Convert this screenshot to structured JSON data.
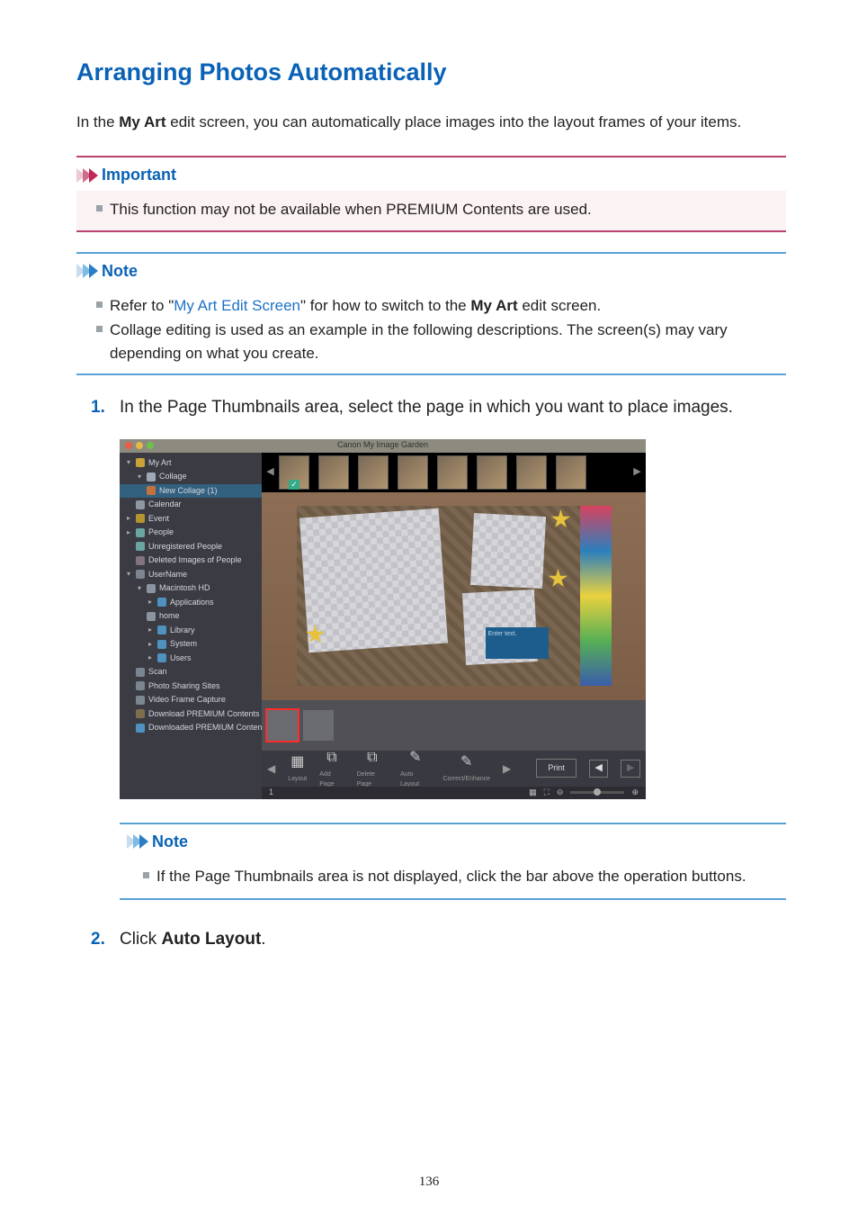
{
  "title": "Arranging Photos Automatically",
  "intro_before": "In the ",
  "intro_bold": "My Art",
  "intro_after": " edit screen, you can automatically place images into the layout frames of your items.",
  "important": {
    "label": "Important",
    "item1": "This function may not be available when PREMIUM Contents are used."
  },
  "note1": {
    "label": "Note",
    "item1_before": "Refer to \"",
    "item1_link": "My Art Edit Screen",
    "item1_after": "\" for how to switch to the ",
    "item1_bold": "My Art",
    "item1_end": " edit screen.",
    "item2": "Collage editing is used as an example in the following descriptions. The screen(s) may vary depending on what you create."
  },
  "step1": "In the Page Thumbnails area, select the page in which you want to place images.",
  "step2_before": "Click ",
  "step2_bold": "Auto Layout",
  "step2_after": ".",
  "inner_note": {
    "label": "Note",
    "item1": "If the Page Thumbnails area is not displayed, click the bar above the operation buttons."
  },
  "screenshot": {
    "window_title": "Canon My Image Garden",
    "tree": {
      "myart": "My Art",
      "collage": "Collage",
      "newcollage": "New Collage (1)",
      "calendar": "Calendar",
      "event": "Event",
      "people": "People",
      "unreg": "Unregistered People",
      "deleted": "Deleted Images of People",
      "username": "UserName",
      "mac": "Macintosh HD",
      "apps": "Applications",
      "home": "home",
      "library": "Library",
      "system": "System",
      "users": "Users",
      "scan": "Scan",
      "sharing": "Photo Sharing Sites",
      "vframe": "Video Frame Capture",
      "dlprem": "Download PREMIUM Contents",
      "dledprem": "Downloaded PREMIUM Contents"
    },
    "enter_text": "Enter text.",
    "toolbar": {
      "layout": "Layout",
      "addpage": "Add Page",
      "delpage": "Delete Page",
      "autolayout": "Auto Layout",
      "correct": "Correct/Enhance",
      "print": "Print"
    },
    "status_left": "1"
  },
  "page_number": "136"
}
